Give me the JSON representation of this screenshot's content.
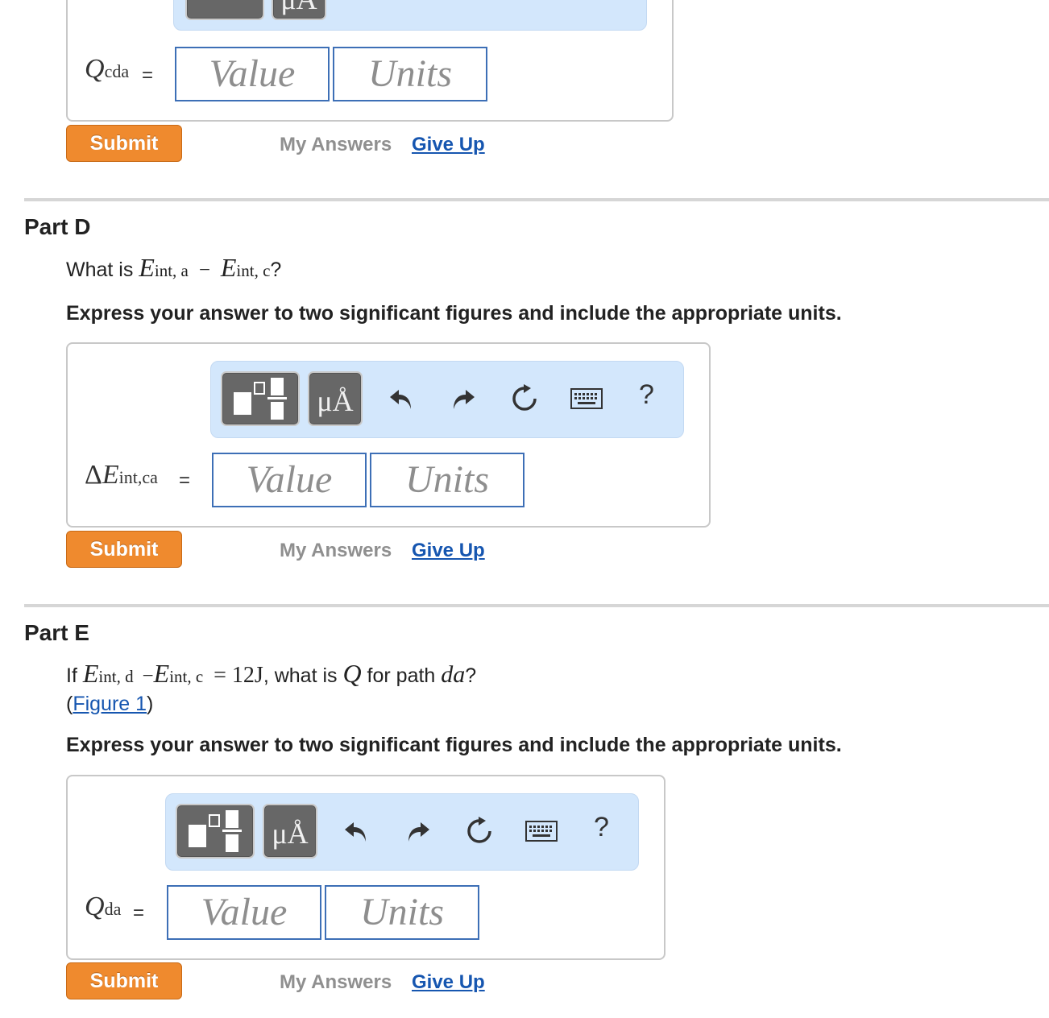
{
  "common": {
    "units_button": "μÅ",
    "help": "?",
    "value_placeholder": "Value",
    "units_placeholder": "Units",
    "submit": "Submit",
    "my_answers": "My Answers",
    "give_up": "Give Up",
    "equals": "="
  },
  "part_c": {
    "label_main": "Q",
    "label_sub": "cda"
  },
  "part_d": {
    "title": "Part D",
    "q_prefix": "What is",
    "q_e1": "E",
    "q_e1_sub": "int, a",
    "q_minus": "−",
    "q_e2": "E",
    "q_e2_sub": "int, c",
    "q_suffix": "?",
    "instruction": "Express your answer to two significant figures and include the appropriate units.",
    "label_delta": "Δ",
    "label_main": "E",
    "label_sub": "int,ca"
  },
  "part_e": {
    "title": "Part E",
    "q_if": "If",
    "q_e1": "E",
    "q_e1_sub": "int, d",
    "q_minus": "−",
    "q_e2": "E",
    "q_e2_sub": "int, c",
    "q_eq": "= 12J",
    "q_mid": ", what is",
    "q_var": "Q",
    "q_for": "for path",
    "q_path": "da",
    "q_end": "?",
    "figure_open": "(",
    "figure_link": "Figure 1",
    "figure_close": ")",
    "instruction": "Express your answer to two significant figures and include the appropriate units.",
    "label_main": "Q",
    "label_sub": "da"
  }
}
